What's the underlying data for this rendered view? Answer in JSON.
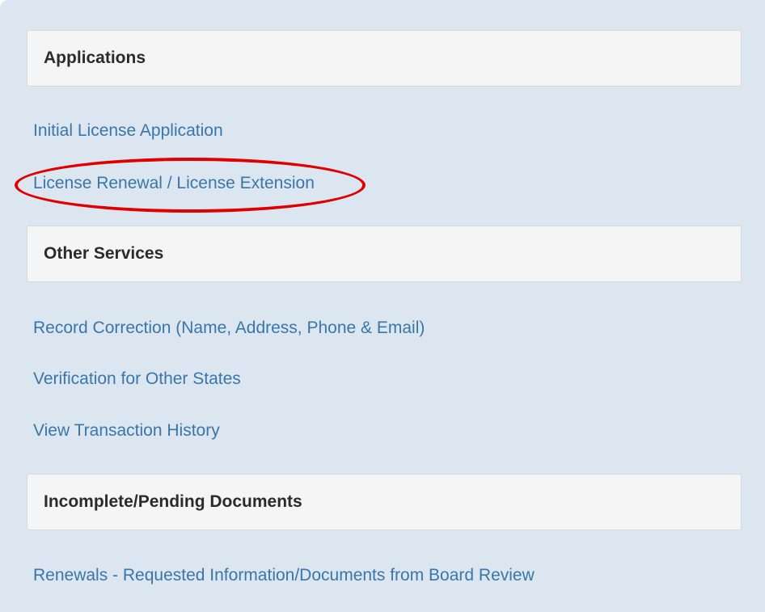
{
  "sections": [
    {
      "header": "Applications",
      "links": [
        "Initial License Application",
        "License Renewal / License Extension"
      ]
    },
    {
      "header": "Other Services",
      "links": [
        "Record Correction (Name, Address, Phone & Email)",
        "Verification for Other States",
        "View Transaction History"
      ]
    },
    {
      "header": "Incomplete/Pending Documents",
      "links": [
        "Renewals - Requested Information/Documents from Board Review"
      ]
    }
  ],
  "colors": {
    "panel_background": "#dce6f1",
    "header_background": "#f5f5f5",
    "link": "#3a76a8",
    "highlight": "#e00000"
  }
}
